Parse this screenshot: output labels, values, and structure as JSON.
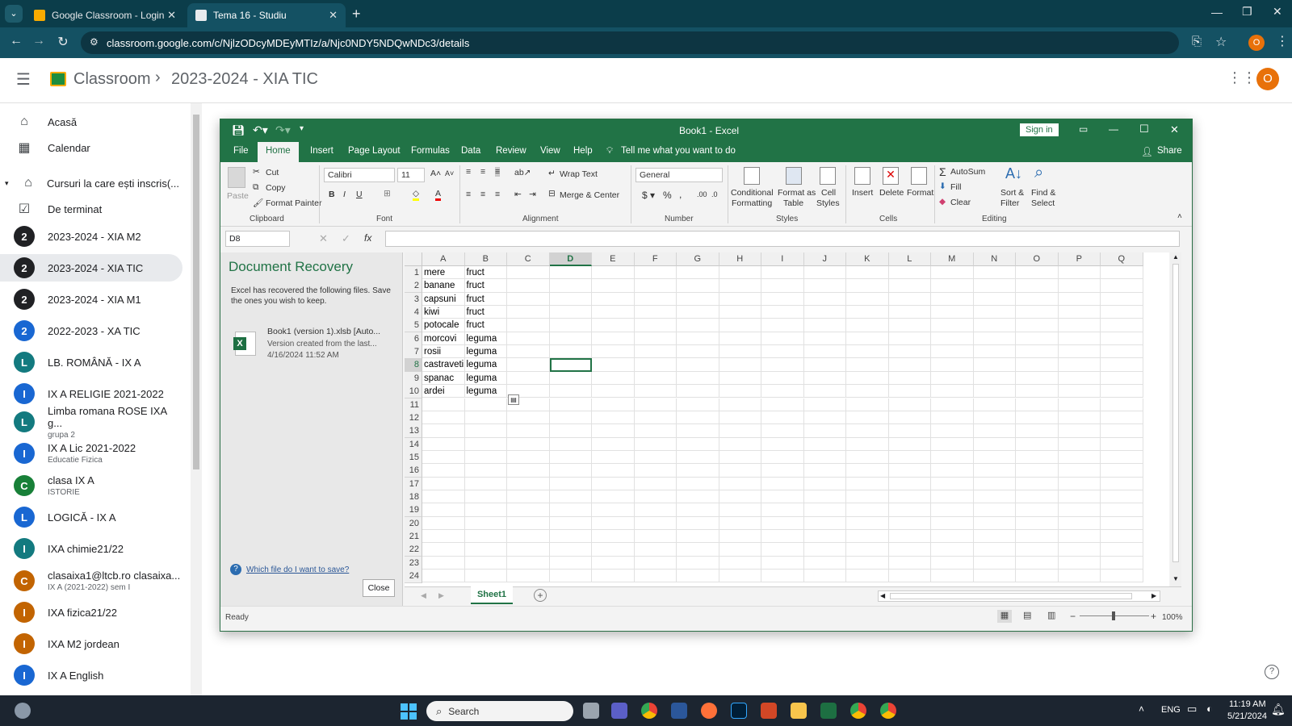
{
  "browser": {
    "tabs": [
      {
        "title": "Google Classroom - Login"
      },
      {
        "title": "Tema 16 - Studiu"
      }
    ],
    "url": "classroom.google.com/c/NjlzODcyMDEyMTIz/a/Njc0NDY5NDQwNDc3/details",
    "profile_initial": "O"
  },
  "classroom": {
    "app_name": "Classroom",
    "breadcrumb_sep": "›",
    "course": "2023-2024 - XIA TIC",
    "profile_initial": "O",
    "sidebar": [
      {
        "type": "icon",
        "icon": "home-icon",
        "label": "Acasă"
      },
      {
        "type": "icon",
        "icon": "calendar-icon",
        "label": "Calendar"
      },
      {
        "type": "section",
        "icon": "school-icon",
        "label": "Cursuri la care ești inscris(..."
      },
      {
        "type": "icon",
        "icon": "todo-icon",
        "label": "De terminat"
      },
      {
        "type": "course",
        "initial": "2",
        "color": "#202124",
        "label": "2023-2024 - XIA M2"
      },
      {
        "type": "course",
        "initial": "2",
        "color": "#202124",
        "label": "2023-2024 - XIA TIC",
        "active": true
      },
      {
        "type": "course",
        "initial": "2",
        "color": "#202124",
        "label": "2023-2024 - XIA M1"
      },
      {
        "type": "course",
        "initial": "2",
        "color": "#1967d2",
        "label": "2022-2023 - XA TIC"
      },
      {
        "type": "course",
        "initial": "L",
        "color": "#137a7f",
        "label": "LB. ROMÂNĂ - IX A"
      },
      {
        "type": "course",
        "initial": "I",
        "color": "#1967d2",
        "label": "IX A RELIGIE 2021-2022"
      },
      {
        "type": "course",
        "initial": "L",
        "color": "#137a7f",
        "label": "Limba romana ROSE IXA g...",
        "sub": "grupa 2"
      },
      {
        "type": "course",
        "initial": "I",
        "color": "#1967d2",
        "label": "IX A Lic 2021-2022",
        "sub": "Educatie Fizica"
      },
      {
        "type": "course",
        "initial": "C",
        "color": "#188038",
        "label": "clasa IX A",
        "sub": "ISTORIE"
      },
      {
        "type": "course",
        "initial": "L",
        "color": "#1967d2",
        "label": "LOGICĂ - IX A"
      },
      {
        "type": "course",
        "initial": "I",
        "color": "#137a7f",
        "label": "IXA chimie21/22"
      },
      {
        "type": "course",
        "initial": "C",
        "color": "#c26401",
        "label": "clasaixa1@ltcb.ro clasaixa...",
        "sub": "IX A (2021-2022) sem I"
      },
      {
        "type": "course",
        "initial": "I",
        "color": "#c26401",
        "label": "IXA fizica21/22"
      },
      {
        "type": "course",
        "initial": "I",
        "color": "#c26401",
        "label": "IXA M2 jordean"
      },
      {
        "type": "course",
        "initial": "I",
        "color": "#1967d2",
        "label": "IX A English"
      }
    ]
  },
  "excel": {
    "title": "Book1 - Excel",
    "sign_in": "Sign in",
    "menu": [
      "File",
      "Home",
      "Insert",
      "Page Layout",
      "Formulas",
      "Data",
      "Review",
      "View",
      "Help"
    ],
    "tell_me": "Tell me what you want to do",
    "share": "Share",
    "ribbon": {
      "clipboard": {
        "paste": "Paste",
        "cut": "Cut",
        "copy": "Copy",
        "format_painter": "Format Painter",
        "label": "Clipboard"
      },
      "font": {
        "name": "Calibri",
        "size": "11",
        "label": "Font"
      },
      "alignment": {
        "wrap": "Wrap Text",
        "merge": "Merge & Center",
        "label": "Alignment"
      },
      "number": {
        "format": "General",
        "label": "Number"
      },
      "styles": {
        "conditional": "Conditional",
        "conditional2": "Formatting",
        "format_as": "Format as",
        "format_as2": "Table",
        "cell_styles": "Cell",
        "cell_styles2": "Styles",
        "label": "Styles"
      },
      "cells": {
        "insert": "Insert",
        "delete": "Delete",
        "format": "Format",
        "label": "Cells"
      },
      "editing": {
        "autosum": "AutoSum",
        "fill": "Fill",
        "clear": "Clear",
        "sort": "Sort &",
        "sort2": "Filter",
        "find": "Find &",
        "find2": "Select",
        "label": "Editing"
      }
    },
    "name_box": "D8",
    "recovery": {
      "title": "Document Recovery",
      "message": "Excel has recovered the following files.  Save the ones you wish to keep.",
      "file_name": "Book1 (version 1).xlsb  [Auto...",
      "file_desc": "Version created from the last...",
      "file_time": "4/16/2024 11:52 AM",
      "help_link": "Which file do I want to save?",
      "close": "Close"
    },
    "columns": [
      "A",
      "B",
      "C",
      "D",
      "E",
      "F",
      "G",
      "H",
      "I",
      "J",
      "K",
      "L",
      "M",
      "N",
      "O",
      "P",
      "Q"
    ],
    "rows": 24,
    "data": [
      [
        "mere",
        "fruct"
      ],
      [
        "banane",
        "fruct"
      ],
      [
        "capsuni",
        "fruct"
      ],
      [
        "kiwi",
        "fruct"
      ],
      [
        "potocale",
        "fruct"
      ],
      [
        "morcovi",
        "leguma"
      ],
      [
        "rosii",
        "leguma"
      ],
      [
        "castraveti",
        "leguma"
      ],
      [
        "spanac",
        "leguma"
      ],
      [
        "ardei",
        "leguma"
      ]
    ],
    "sheet": "Sheet1",
    "status": "Ready",
    "zoom": "100%"
  },
  "taskbar": {
    "search": "Search",
    "lang": "ENG",
    "time": "11:19 AM",
    "date": "5/21/2024"
  }
}
